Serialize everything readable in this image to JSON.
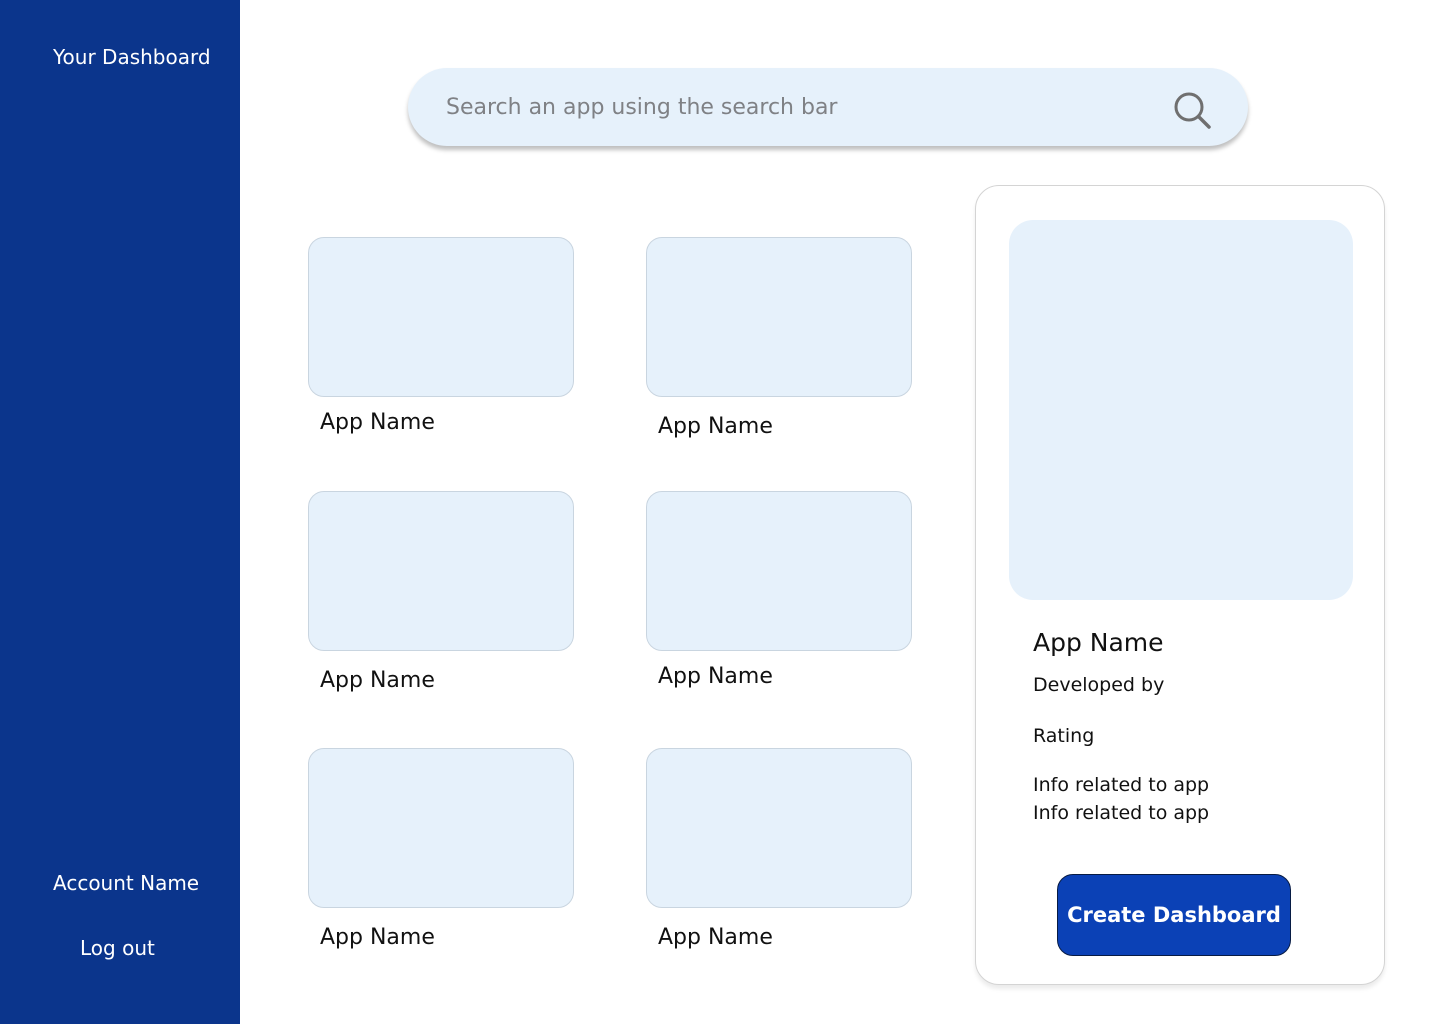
{
  "sidebar": {
    "title": "Your Dashboard",
    "account": "Account Name",
    "logout": "Log out",
    "background_color": "#0b358c"
  },
  "search": {
    "placeholder": "Search an app using the search bar",
    "value": "",
    "icon": "search-icon"
  },
  "apps": [
    {
      "name": "App Name"
    },
    {
      "name": "App Name"
    },
    {
      "name": "App Name"
    },
    {
      "name": "App Name"
    },
    {
      "name": "App Name"
    },
    {
      "name": "App Name"
    }
  ],
  "detail": {
    "title": "App Name",
    "developed_by": "Developed by",
    "rating": "Rating",
    "info": [
      "Info related to app",
      "Info related to app"
    ],
    "create_button": "Create Dashboard",
    "button_color": "#0b41b6",
    "preview_color": "#e6f1fb"
  }
}
